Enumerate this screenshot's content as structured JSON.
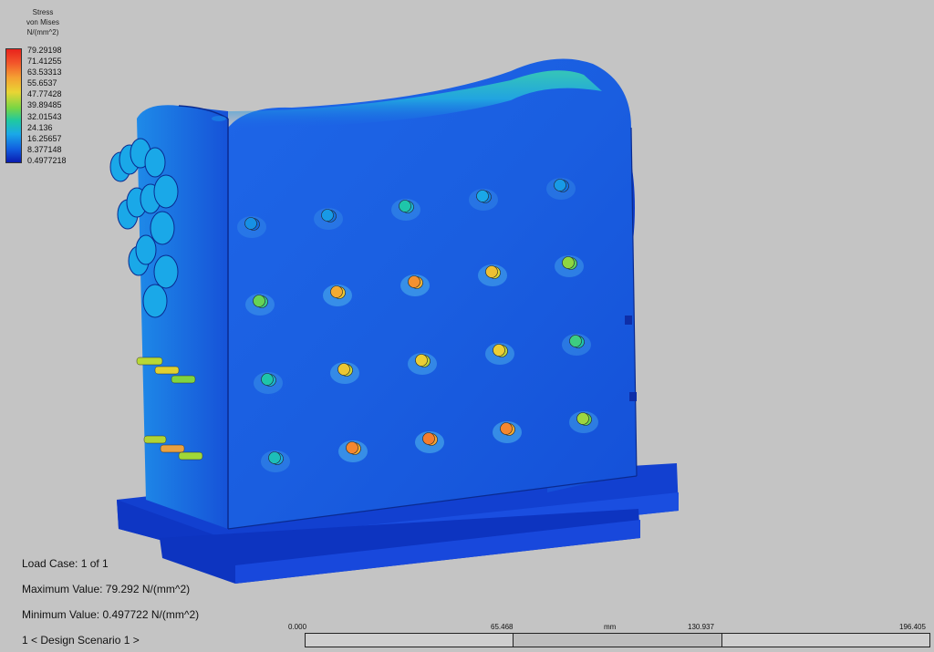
{
  "legend": {
    "title_line1": "Stress",
    "title_line2": "von Mises",
    "title_line3": "N/(mm^2)",
    "values": [
      "79.29198",
      "71.41255",
      "63.53313",
      "55.6537",
      "47.77428",
      "39.89485",
      "32.01543",
      "24.136",
      "16.25657",
      "8.377148",
      "0.4977218"
    ],
    "colors": [
      "#e8231c",
      "#f5a032",
      "#e9d534",
      "#78d644",
      "#1fc9a0",
      "#1aa8e8",
      "#1160e0",
      "#0a1cb0"
    ]
  },
  "info": {
    "load_case": "Load Case:  1 of 1",
    "max_value": "Maximum Value: 79.292 N/(mm^2)",
    "min_value": "Minimum Value: 0.497722 N/(mm^2)",
    "design_scenario": "1 < Design Scenario 1 >"
  },
  "scale_bar": {
    "ticks": [
      "0.000",
      "65.468",
      "mm",
      "130.937",
      "196.405"
    ]
  },
  "model": {
    "main_color": "#1a5ee0",
    "dark_color": "#0c2fb0",
    "pin_stress_levels": [
      [
        0.1,
        0.12,
        0.28,
        0.15,
        0.12
      ],
      [
        0.42,
        0.72,
        0.78,
        0.66,
        0.48
      ],
      [
        0.28,
        0.64,
        0.62,
        0.62,
        0.35
      ],
      [
        0.25,
        0.8,
        0.82,
        0.8,
        0.5
      ]
    ]
  }
}
